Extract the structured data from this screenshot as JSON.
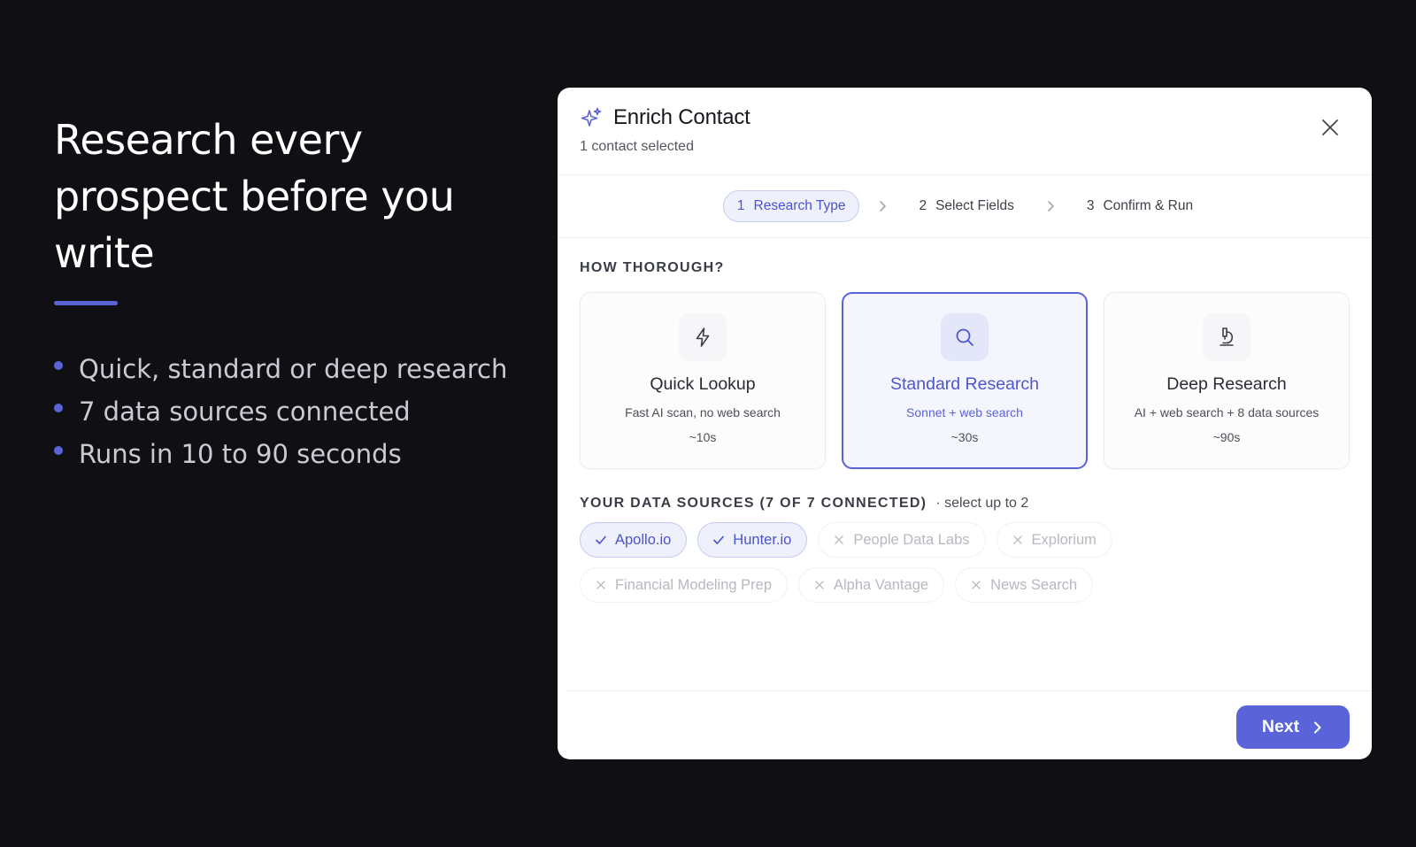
{
  "colors": {
    "accent": "#5a63d6",
    "button": "#5b63d9",
    "bullet": "#5b63d9"
  },
  "hero": {
    "title": "Research every prospect before you write",
    "bullets": [
      "Quick, standard or deep research",
      "7 data sources connected",
      "Runs in 10 to 90 seconds"
    ]
  },
  "dialog": {
    "icon": "sparkle-icon",
    "title": "Enrich Contact",
    "subtitle": "1 contact selected",
    "close_icon": "close-icon"
  },
  "stepper": {
    "steps": [
      {
        "num": "1",
        "label": "Research Type",
        "active": true
      },
      {
        "num": "2",
        "label": "Select Fields",
        "active": false
      },
      {
        "num": "3",
        "label": "Confirm & Run",
        "active": false
      }
    ]
  },
  "thoroughness": {
    "label": "HOW THOROUGH?",
    "options": [
      {
        "icon": "lightning-icon",
        "title": "Quick Lookup",
        "desc": "Fast AI scan, no web search",
        "time": "~10s",
        "selected": false
      },
      {
        "icon": "search-icon",
        "title": "Standard Research",
        "desc": "Sonnet + web search",
        "time": "~30s",
        "selected": true
      },
      {
        "icon": "microscope-icon",
        "title": "Deep Research",
        "desc": "AI + web search + 8 data sources",
        "time": "~90s",
        "selected": false
      }
    ]
  },
  "sources": {
    "label": "YOUR DATA SOURCES (7 OF 7 CONNECTED)",
    "hint": "· select up to 2",
    "chips": [
      {
        "label": "Apollo.io",
        "selected": true
      },
      {
        "label": "Hunter.io",
        "selected": true
      },
      {
        "label": "People Data Labs",
        "selected": false
      },
      {
        "label": "Explorium",
        "selected": false
      },
      {
        "label": "Financial Modeling Prep",
        "selected": false
      },
      {
        "label": "Alpha Vantage",
        "selected": false
      },
      {
        "label": "News Search",
        "selected": false
      }
    ]
  },
  "footer": {
    "next_label": "Next"
  }
}
